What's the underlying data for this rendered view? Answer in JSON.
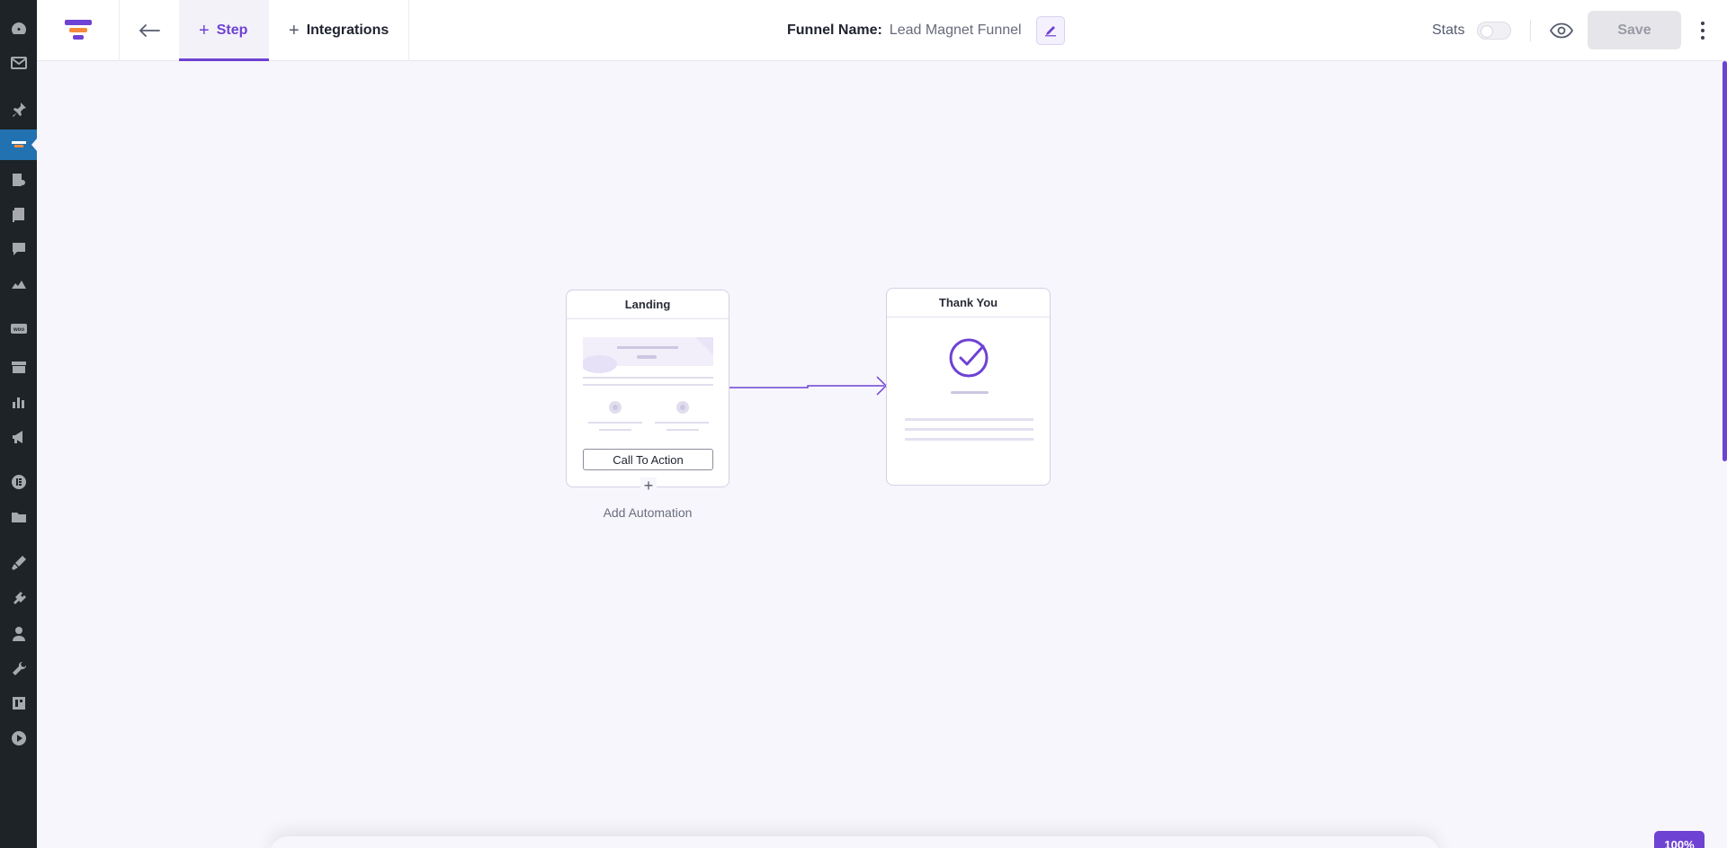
{
  "wp_sidebar": {
    "icons": [
      "dashboard-icon",
      "mail-icon",
      "pin-icon",
      "funnel-icon",
      "media-icon",
      "pages-icon",
      "comments-icon",
      "products-icon",
      "woo-icon",
      "archive-icon",
      "analytics-icon",
      "marketing-icon",
      "elementor-icon",
      "templates-icon",
      "appearance-icon",
      "plugins-icon",
      "users-icon",
      "tools-icon",
      "settings-icon",
      "play-icon"
    ]
  },
  "header": {
    "tabs": [
      {
        "label": "Step",
        "active": true
      },
      {
        "label": "Integrations",
        "active": false
      }
    ],
    "funnel_name_label": "Funnel Name:",
    "funnel_name_value": "Lead Magnet Funnel",
    "stats_label": "Stats",
    "save_label": "Save",
    "accent_color": "#6e42d3"
  },
  "canvas": {
    "nodes": {
      "landing": {
        "title": "Landing",
        "cta_label": "Call To Action"
      },
      "thank_you": {
        "title": "Thank You"
      }
    },
    "add_automation_label": "Add Automation",
    "zoom_label": "100%"
  }
}
